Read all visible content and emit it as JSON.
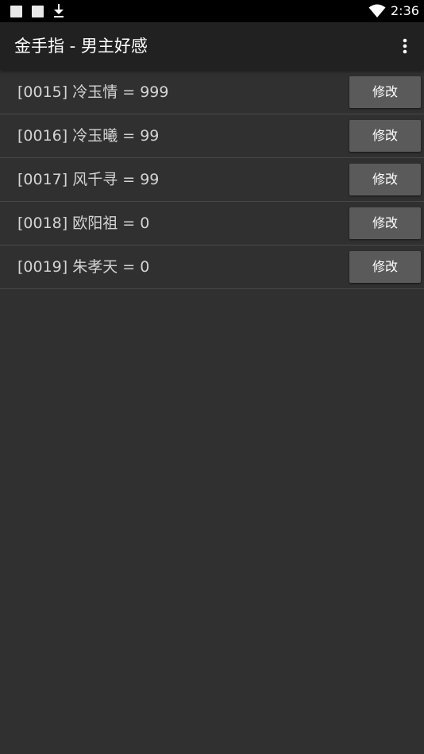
{
  "status_bar": {
    "time": "2:36",
    "icons": [
      "notification-square-icon",
      "notification-square-icon",
      "download-icon",
      "wifi-icon"
    ],
    "background": "#000000"
  },
  "app_bar": {
    "title": "金手指 - 男主好感",
    "menu_icon": "more-vert-icon",
    "background": "#212121"
  },
  "list": {
    "items": [
      {
        "label": "[0015] 冷玉情 = 999",
        "button": "修改"
      },
      {
        "label": "[0016] 冷玉曦 = 99",
        "button": "修改"
      },
      {
        "label": "[0017] 风千寻 = 99",
        "button": "修改"
      },
      {
        "label": "[0018] 欧阳祖 = 0",
        "button": "修改"
      },
      {
        "label": "[0019] 朱孝天 = 0",
        "button": "修改"
      }
    ]
  },
  "colors": {
    "page_background": "#303030",
    "button_background": "#5a5a5a",
    "label_text": "#d4d4d4",
    "divider": "#484848"
  }
}
